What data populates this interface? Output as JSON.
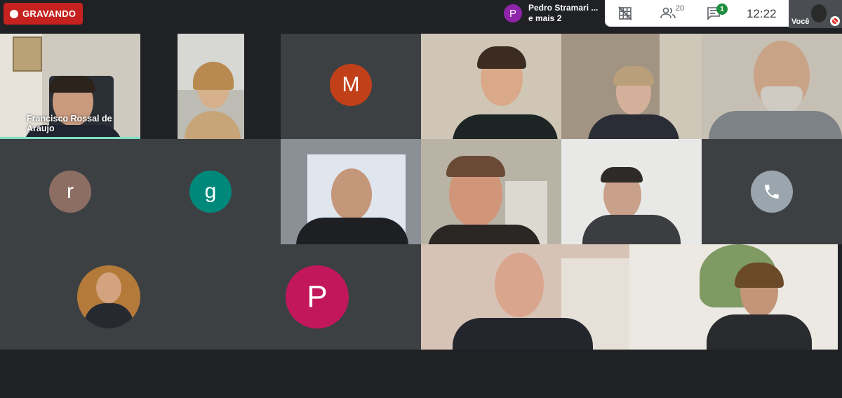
{
  "recording": {
    "label": "GRAVANDO",
    "color": "#c5221f"
  },
  "presenter": {
    "initial": "P",
    "name": "Pedro Stramari ...",
    "more": "e mais 2"
  },
  "toolbar": {
    "grid_icon": "grid-off-icon",
    "people_icon": "people-icon",
    "people_count": "20",
    "chat_icon": "chat-icon",
    "chat_badge": "1",
    "time": "12:22"
  },
  "self_view": {
    "label": "Você",
    "mic_status": "mic-off-icon"
  },
  "participants": {
    "francisco": {
      "name": "Francisco Rossal de Araujo"
    },
    "m": {
      "initial": "M",
      "color": "#c1401a"
    },
    "r": {
      "initial": "r",
      "color": "#8d6e63"
    },
    "g": {
      "initial": "g",
      "color": "#00897b"
    },
    "p": {
      "initial": "P",
      "color": "#c2185b"
    },
    "phone": {
      "icon": "phone-icon",
      "color": "#9aa5ad"
    }
  }
}
